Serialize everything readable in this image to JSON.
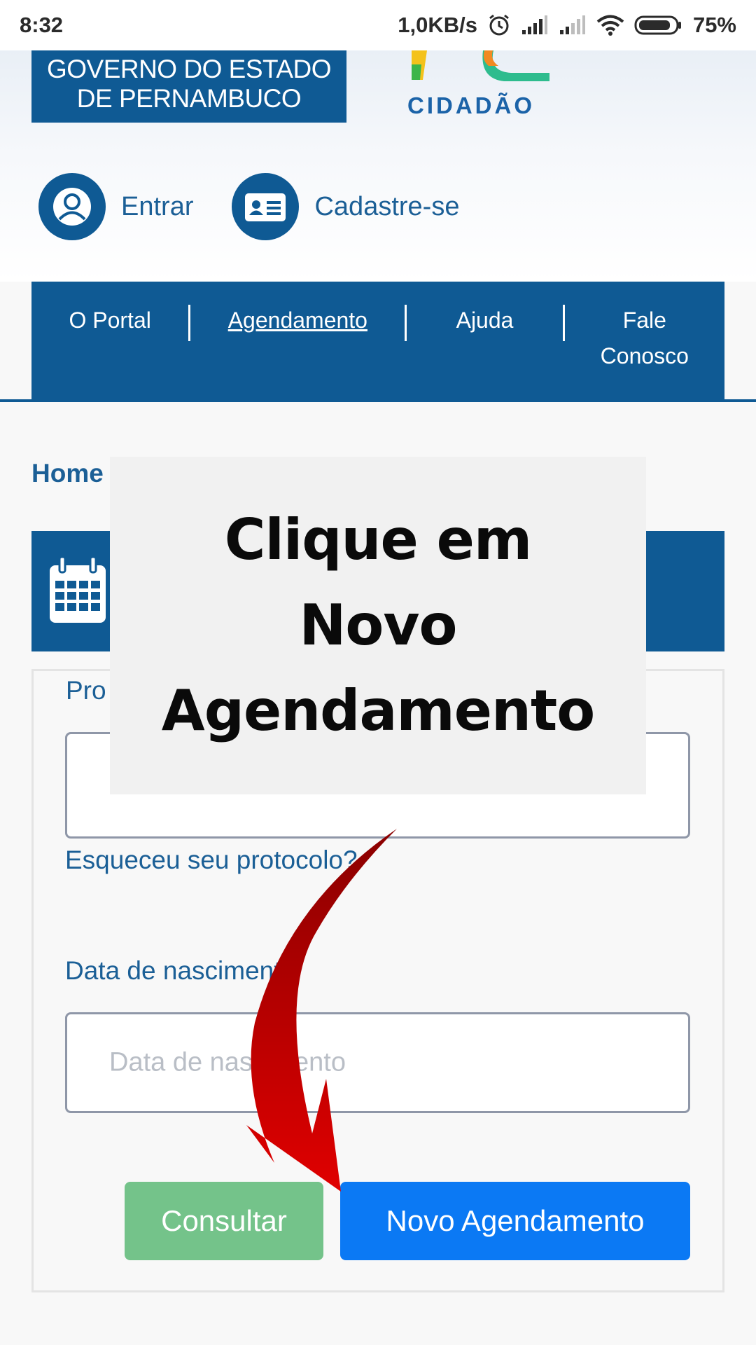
{
  "status_bar": {
    "time": "8:32",
    "network_speed": "1,0KB/s",
    "battery": "75%",
    "icons": [
      "alarm-icon",
      "signal-icon",
      "signal-icon",
      "wifi-icon",
      "battery-icon"
    ]
  },
  "header": {
    "gov_logo_line1": "GOVERNO DO ESTADO",
    "gov_logo_line2": "DE PERNAMBUCO",
    "cidadao_logo": "CIDADÃO",
    "login_label": "Entrar",
    "register_label": "Cadastre-se"
  },
  "nav": {
    "items": [
      {
        "label": "O Portal"
      },
      {
        "label": "Agendamento",
        "active": true
      },
      {
        "label": "Ajuda"
      },
      {
        "label_line1": "Fale",
        "label_line2": "Conosco"
      }
    ]
  },
  "breadcrumb": "Home",
  "form": {
    "protocol_label": "Pro",
    "forgot_protocol_link": "Esqueceu seu protocolo?",
    "birth_label": "Data de nascimento",
    "birth_placeholder": "Data de nascimento",
    "consultar_button": "Consultar",
    "novo_agendamento_button": "Novo Agendamento"
  },
  "overlay": {
    "line1": "Clique em",
    "line2": "Novo",
    "line3": "Agendamento"
  },
  "colors": {
    "brand_blue": "#0f5a94",
    "link_blue": "#1b5f96",
    "primary_button": "#0b79f4",
    "success_button": "#74c38a",
    "arrow_red": "#c40000"
  }
}
